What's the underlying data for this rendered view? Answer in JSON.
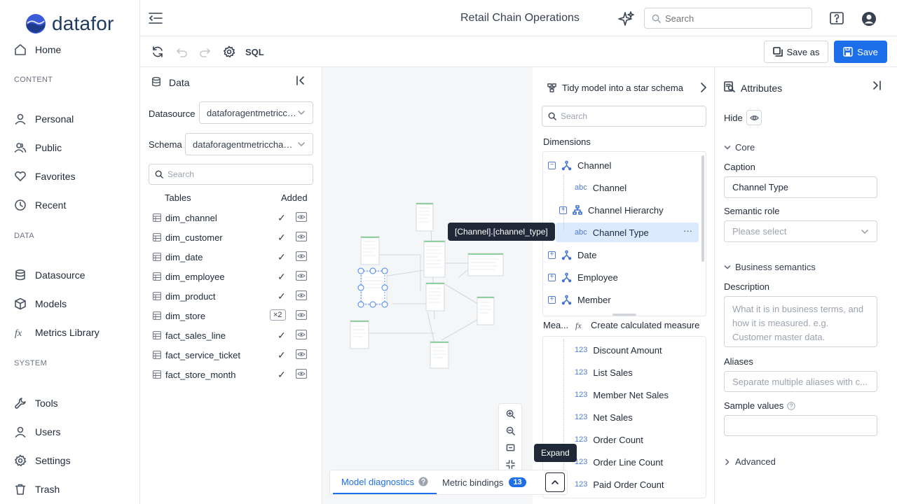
{
  "brand": {
    "name": "datafor"
  },
  "sidebar": {
    "home": "Home",
    "sections": {
      "content": "CONTENT",
      "data": "DATA",
      "system": "SYSTEM"
    },
    "content_items": [
      "Personal",
      "Public",
      "Favorites",
      "Recent"
    ],
    "data_items": [
      "Datasource",
      "Models",
      "Metrics Library"
    ],
    "system_items": [
      "Tools",
      "Users",
      "Settings",
      "Trash"
    ]
  },
  "topbar": {
    "title": "Retail Chain Operations",
    "search_placeholder": "Search"
  },
  "toolbar": {
    "sql_label": "SQL",
    "save_as_label": "Save as",
    "save_label": "Save"
  },
  "data_panel": {
    "title": "Data",
    "datasource_label": "Datasource",
    "datasource_value": "dataforagentmetricchannel",
    "schema_label": "Schema",
    "schema_value": "dataforagentmetricchannel",
    "search_placeholder": "Search",
    "col_tables": "Tables",
    "col_added": "Added",
    "tables": [
      {
        "name": "dim_channel",
        "added": "✓"
      },
      {
        "name": "dim_customer",
        "added": "✓"
      },
      {
        "name": "dim_date",
        "added": "✓"
      },
      {
        "name": "dim_employee",
        "added": "✓"
      },
      {
        "name": "dim_product",
        "added": "✓"
      },
      {
        "name": "dim_store",
        "added": "×2"
      },
      {
        "name": "fact_sales_line",
        "added": "✓"
      },
      {
        "name": "fact_service_ticket",
        "added": "✓"
      },
      {
        "name": "fact_store_month",
        "added": "✓"
      }
    ]
  },
  "canvas": {
    "tooltip_path": "[Channel].[channel_type]",
    "tooltip_expand": "Expand",
    "tab_diagnostics": "Model diagnostics",
    "tab_metric_bindings": "Metric bindings",
    "metric_bindings_count": "13"
  },
  "fields_panel": {
    "tidy_label": "Tidy model into a star schema",
    "search_placeholder": "Search",
    "dimensions_label": "Dimensions",
    "dimensions": {
      "channel": "Channel",
      "channel_attr": "Channel",
      "channel_hierarchy": "Channel Hierarchy",
      "channel_type": "Channel Type",
      "date": "Date",
      "employee": "Employee",
      "member": "Member"
    },
    "measures_label": "Mea...",
    "create_measure_label": "Create calculated measure",
    "measures": [
      "Discount Amount",
      "List Sales",
      "Member Net Sales",
      "Net Sales",
      "Order Count",
      "Order Line Count",
      "Paid Order Count"
    ],
    "type_abc": "abc",
    "type_num": "123",
    "more": "···"
  },
  "attributes": {
    "title": "Attributes",
    "hide_label": "Hide",
    "core_label": "Core",
    "caption_label": "Caption",
    "caption_value": "Channel Type",
    "semantic_role_label": "Semantic role",
    "semantic_role_placeholder": "Please select",
    "business_label": "Business semantics",
    "description_label": "Description",
    "description_placeholder": "What it is in business terms, and how it is measured. e.g. Customer master data.",
    "aliases_label": "Aliases",
    "aliases_placeholder": "Separate multiple aliases with c...",
    "sample_values_label": "Sample values",
    "advanced_label": "Advanced"
  }
}
